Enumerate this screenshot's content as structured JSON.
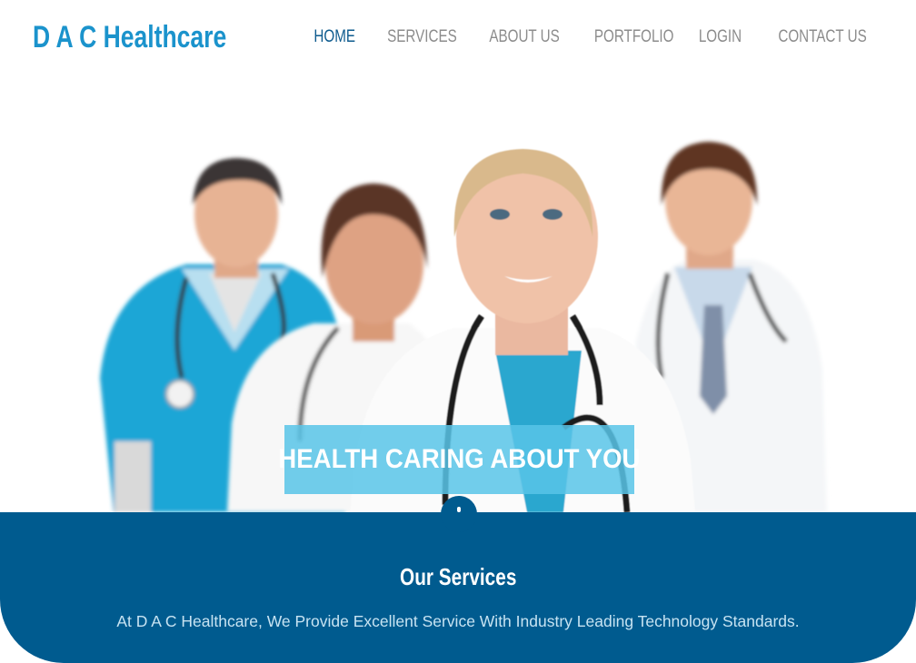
{
  "brand": {
    "name": "D A C Healthcare",
    "color": "#1b93cc"
  },
  "nav": {
    "items": [
      {
        "label": "HOME",
        "active": true
      },
      {
        "label": "SERVICES",
        "active": false
      },
      {
        "label": "ABOUT US",
        "active": false
      },
      {
        "label": "PORTFOLIO",
        "active": false
      },
      {
        "label": "LOGIN",
        "active": false
      },
      {
        "label": "CONTACT US",
        "active": false
      }
    ],
    "active_color": "#0e5b8e",
    "inactive_color": "#8c8c8c"
  },
  "hero": {
    "tagline": "HEALTH CARING ABOUT YOU",
    "image_subject": "four smiling doctors with stethoscopes"
  },
  "services": {
    "title": "Our Services",
    "description": "At D A C Healthcare, We Provide Excellent Service With Industry Leading Technology Standards.",
    "background": "#005b8f"
  }
}
